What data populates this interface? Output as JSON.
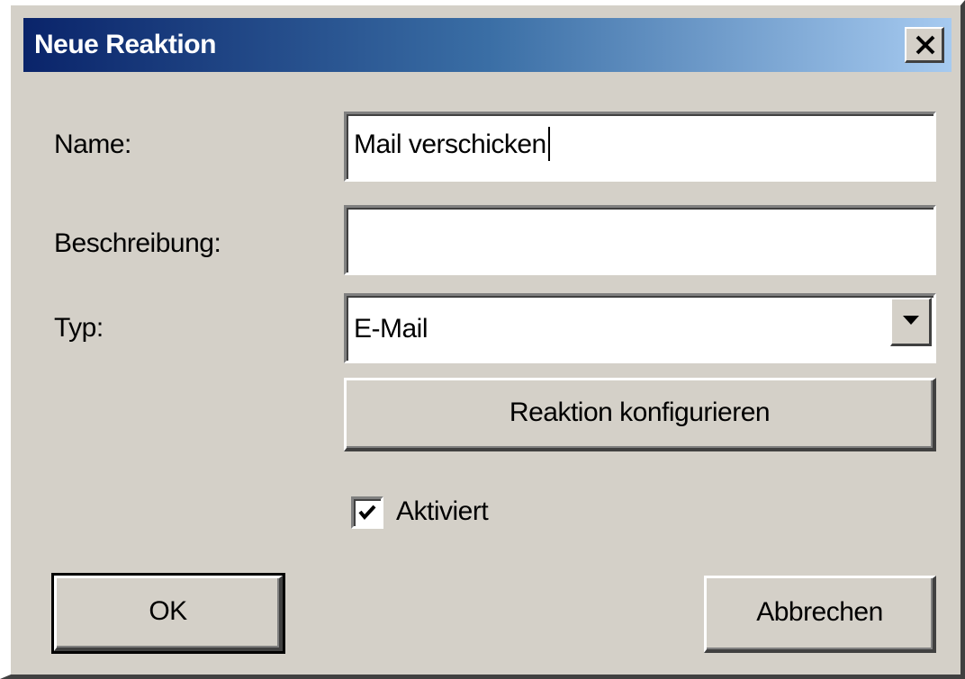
{
  "window": {
    "title": "Neue Reaktion",
    "close_icon": "close-icon"
  },
  "form": {
    "name_label": "Name:",
    "name_value": "Mail verschicken",
    "description_label": "Beschreibung:",
    "description_value": "",
    "type_label": "Typ:",
    "type_value": "E-Mail",
    "type_dropdown_icon": "chevron-down-icon",
    "configure_button": "Reaktion konfigurieren",
    "activated_label": "Aktiviert",
    "activated_checked": true
  },
  "footer": {
    "ok_label": "OK",
    "cancel_label": "Abbrechen"
  }
}
